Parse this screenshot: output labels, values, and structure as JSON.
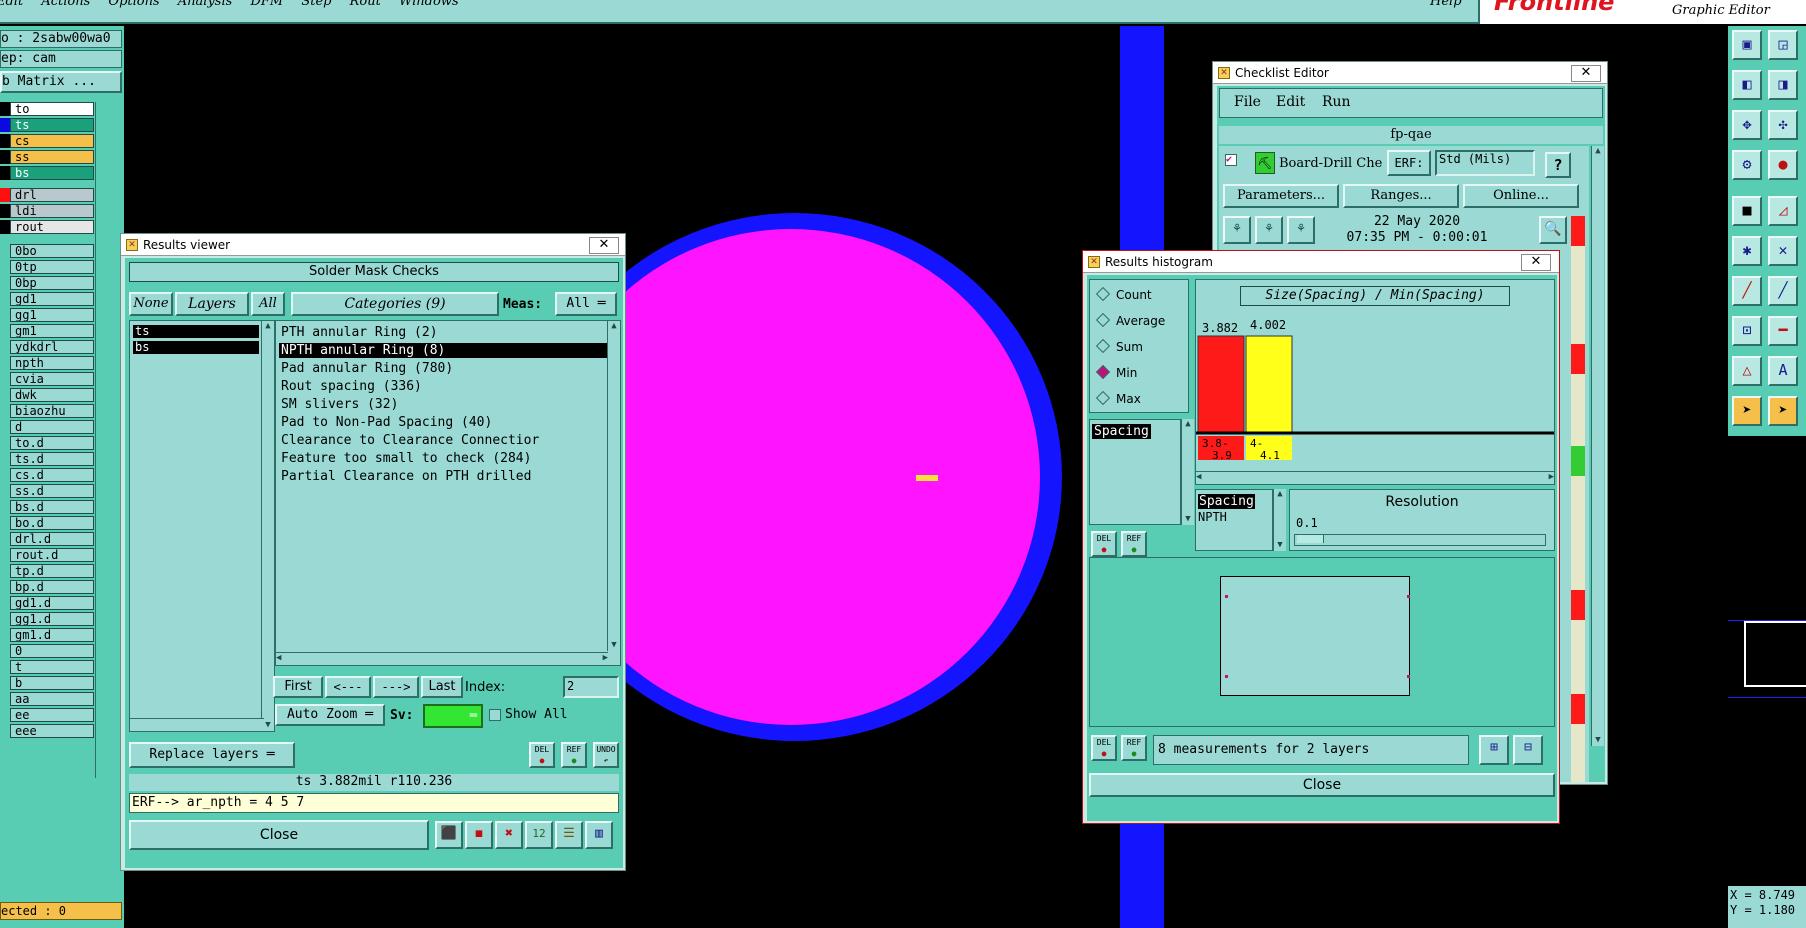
{
  "menubar": {
    "items": [
      "Edit",
      "Actions",
      "Options",
      "Analysis",
      "DFM",
      "Step",
      "Rout",
      "Windows"
    ],
    "help": "Help",
    "brand": "Frontline",
    "subtitle": "Graphic Editor"
  },
  "left_panel": {
    "job": "o : 2sabw00wa0",
    "step": "ep: cam",
    "matrix_button": "b Matrix ...",
    "selected": "ected : 0",
    "layers": [
      {
        "name": "to",
        "color": "#ffffff",
        "swatch": "#000000"
      },
      {
        "name": "ts",
        "color": "#1aa07a",
        "swatch": "#0a0ae0"
      },
      {
        "name": "cs",
        "color": "#f5c04a",
        "swatch": "#000000"
      },
      {
        "name": "ss",
        "color": "#f5c04a",
        "swatch": "#000000"
      },
      {
        "name": "bs",
        "color": "#1aa07a",
        "swatch": "#000000"
      },
      {
        "name": "drl",
        "color": "#b9c8cc",
        "swatch": "#ff1010"
      },
      {
        "name": "ldi",
        "color": "#b9c8cc",
        "swatch": "#000000"
      },
      {
        "name": "rout",
        "color": "#e6e6e6",
        "swatch": "#000000"
      },
      {
        "name": "0bo",
        "color": "#9ad9d4",
        "swatch": ""
      },
      {
        "name": "0tp",
        "color": "#9ad9d4",
        "swatch": ""
      },
      {
        "name": "0bp",
        "color": "#9ad9d4",
        "swatch": ""
      },
      {
        "name": "gd1",
        "color": "#9ad9d4",
        "swatch": ""
      },
      {
        "name": "gg1",
        "color": "#9ad9d4",
        "swatch": ""
      },
      {
        "name": "gm1",
        "color": "#9ad9d4",
        "swatch": ""
      },
      {
        "name": "ydkdrl",
        "color": "#9ad9d4",
        "swatch": ""
      },
      {
        "name": "npth",
        "color": "#9ad9d4",
        "swatch": ""
      },
      {
        "name": "cvia",
        "color": "#9ad9d4",
        "swatch": ""
      },
      {
        "name": "dwk",
        "color": "#9ad9d4",
        "swatch": ""
      },
      {
        "name": "biaozhu",
        "color": "#9ad9d4",
        "swatch": ""
      },
      {
        "name": "d",
        "color": "#9ad9d4",
        "swatch": ""
      },
      {
        "name": "to.d",
        "color": "#9ad9d4",
        "swatch": ""
      },
      {
        "name": "ts.d",
        "color": "#9ad9d4",
        "swatch": ""
      },
      {
        "name": "cs.d",
        "color": "#9ad9d4",
        "swatch": ""
      },
      {
        "name": "ss.d",
        "color": "#9ad9d4",
        "swatch": ""
      },
      {
        "name": "bs.d",
        "color": "#9ad9d4",
        "swatch": ""
      },
      {
        "name": "bo.d",
        "color": "#9ad9d4",
        "swatch": ""
      },
      {
        "name": "drl.d",
        "color": "#9ad9d4",
        "swatch": ""
      },
      {
        "name": "rout.d",
        "color": "#9ad9d4",
        "swatch": ""
      },
      {
        "name": "tp.d",
        "color": "#9ad9d4",
        "swatch": ""
      },
      {
        "name": "bp.d",
        "color": "#9ad9d4",
        "swatch": ""
      },
      {
        "name": "gd1.d",
        "color": "#9ad9d4",
        "swatch": ""
      },
      {
        "name": "gg1.d",
        "color": "#9ad9d4",
        "swatch": ""
      },
      {
        "name": "gm1.d",
        "color": "#9ad9d4",
        "swatch": ""
      },
      {
        "name": "0",
        "color": "#9ad9d4",
        "swatch": ""
      },
      {
        "name": "t",
        "color": "#9ad9d4",
        "swatch": ""
      },
      {
        "name": "b",
        "color": "#9ad9d4",
        "swatch": ""
      },
      {
        "name": "aa",
        "color": "#9ad9d4",
        "swatch": ""
      },
      {
        "name": "ee",
        "color": "#9ad9d4",
        "swatch": ""
      },
      {
        "name": "eee",
        "color": "#9ad9d4",
        "swatch": ""
      }
    ]
  },
  "results_viewer": {
    "title": "Results viewer",
    "header": "Solder Mask Checks",
    "none_btn": "None",
    "layers_btn": "Layers",
    "all_btn": "All",
    "categories_btn": "Categories (9)",
    "meas_label": "Meas:",
    "meas_value": "All",
    "layer_list": [
      "ts",
      "bs"
    ],
    "categories": [
      "PTH annular Ring (2)",
      "NPTH annular Ring (8)",
      "Pad annular Ring (780)",
      "Rout spacing (336)",
      "SM slivers (32)",
      "Pad to Non-Pad Spacing (40)",
      "Clearance to Clearance Connectior",
      "Feature too small to check (284)",
      "Partial Clearance on PTH drilled"
    ],
    "selected_category": 1,
    "first_btn": "First",
    "prev_btn": "<---",
    "next_btn": "--->",
    "last_btn": "Last",
    "index_label": "Index:",
    "index_value": "2",
    "auto_zoom": "Auto Zoom",
    "sv_label": "Sv:",
    "show_all": "Show All",
    "replace_layers": "Replace layers",
    "del": "DEL",
    "ref": "REF",
    "undo": "UNDO",
    "status": "ts 3.882mil  r110.236",
    "erf_line": "ERF--> ar_npth = 4 5 7",
    "close": "Close"
  },
  "checklist_editor": {
    "title": "Checklist Editor",
    "menus": [
      "File",
      "Edit",
      "Run"
    ],
    "checklist_name": "fp-qae",
    "check_name": "Board-Drill Che",
    "erf_label": "ERF:",
    "erf_value": "Std (Mils)",
    "help_btn": "?",
    "parameters_btn": "Parameters...",
    "ranges_btn": "Ranges...",
    "online_btn": "Online...",
    "date": "22 May 2020",
    "time": "07:35 PM - 0:00:01"
  },
  "histogram": {
    "title": "Results histogram",
    "modes": [
      "Count",
      "Average",
      "Sum",
      "Min",
      "Max"
    ],
    "selected_mode": "Min",
    "measure_list": [
      "Spacing"
    ],
    "chart_title": "Size(Spacing) / Min(Spacing)",
    "resolution_label": "Resolution",
    "resolution_value": "0.1",
    "sublist": [
      "Spacing",
      "NPTH"
    ],
    "summary": "8 measurements for 2 layers",
    "close": "Close",
    "del": "DEL",
    "ref": "REF",
    "bins": [
      {
        "label_top": "3.8-",
        "label_bottom": "3.9",
        "value": "3.882",
        "color": "#ff1a1a"
      },
      {
        "label_top": "4-",
        "label_bottom": "4.1",
        "value": "4.002",
        "color": "#ffff1a"
      }
    ]
  },
  "coords": {
    "x": "X = 8.749",
    "y": "Y = 1.180"
  },
  "colors": {
    "pad_fill": "#ff14ff",
    "pad_ring": "#1414ff",
    "panel": "#9ad9d4",
    "frame": "#58cdb3"
  }
}
